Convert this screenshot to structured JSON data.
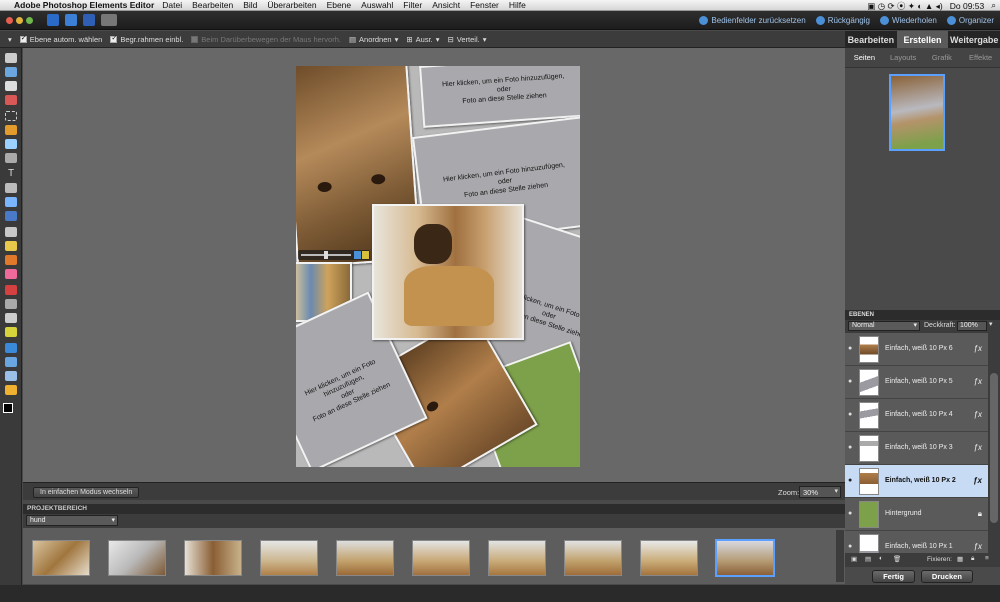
{
  "menubar": {
    "app_name": "Adobe Photoshop Elements Editor",
    "items": [
      "Datei",
      "Bearbeiten",
      "Bild",
      "Überarbeiten",
      "Ebene",
      "Auswahl",
      "Filter",
      "Ansicht",
      "Fenster",
      "Hilfe"
    ],
    "clock": "Do 09:53"
  },
  "appbar": {
    "reset_panels": "Bedienfelder zurücksetzen",
    "undo": "Rückgängig",
    "redo": "Wiederholen",
    "organizer": "Organizer"
  },
  "options": {
    "auto_select_layer": "Ebene autom. wählen",
    "bounding_box": "Begr.rahmen einbl.",
    "highlight_rollover": "Beim Darüberbewegen der Maus hervorh.",
    "arrange": "Anordnen",
    "align": "Ausr.",
    "distribute": "Verteil."
  },
  "canvas": {
    "placeholder_1": [
      "Hier klicken, um ein Foto hinzuzufügen,",
      "oder",
      "Foto an diese Stelle ziehen"
    ],
    "placeholder_2": [
      "Hier klicken, um ein Foto hinzuzufügen,",
      "oder",
      "Foto an diese Stelle ziehen"
    ],
    "placeholder_3": [
      "Hier klicken, um ein Foto hinzu",
      "oder",
      "Foto an diese Stelle ziehen"
    ],
    "placeholder_4": [
      "Hier klicken, um ein Foto hinzuzufügen,",
      "oder",
      "Foto an diese Stelle ziehen"
    ]
  },
  "canvasbar": {
    "simple_mode_button": "In einfachen Modus wechseln",
    "zoom_label": "Zoom:",
    "zoom_value": "30%"
  },
  "project_bin": {
    "title": "PROJEKTBEREICH",
    "filter": "hund",
    "thumb_count": 10,
    "selected_index": 9
  },
  "right_panel": {
    "tabs": [
      "Bearbeiten",
      "Erstellen",
      "Weitergabe"
    ],
    "active_tab": 1,
    "subtabs": [
      "Seiten",
      "Layouts",
      "Grafik",
      "Effekte"
    ],
    "active_subtab": 0
  },
  "layers_panel": {
    "title": "EBENEN",
    "blend_mode": "Normal",
    "opacity_label": "Deckkraft:",
    "opacity_value": "100%",
    "lock_label": "Fixieren:",
    "layers": [
      {
        "name": "Einfach, weiß 10 Px 6",
        "selected": false,
        "fx": true
      },
      {
        "name": "Einfach, weiß 10 Px 5",
        "selected": false,
        "fx": true
      },
      {
        "name": "Einfach, weiß 10 Px 4",
        "selected": false,
        "fx": true
      },
      {
        "name": "Einfach, weiß 10 Px 3",
        "selected": false,
        "fx": true
      },
      {
        "name": "Einfach, weiß 10 Px 2",
        "selected": true,
        "fx": true
      },
      {
        "name": "Hintergrund",
        "selected": false,
        "fx": false,
        "locked": true
      },
      {
        "name": "Einfach, weiß 10 Px 1",
        "selected": false,
        "fx": true
      }
    ]
  },
  "buttons": {
    "done": "Fertig",
    "print": "Drucken"
  },
  "colors": {
    "accent": "#5ba0ff",
    "panel": "#4a4a4a",
    "selected_layer": "#c7dbf4",
    "green_frame": "#7da04a"
  }
}
